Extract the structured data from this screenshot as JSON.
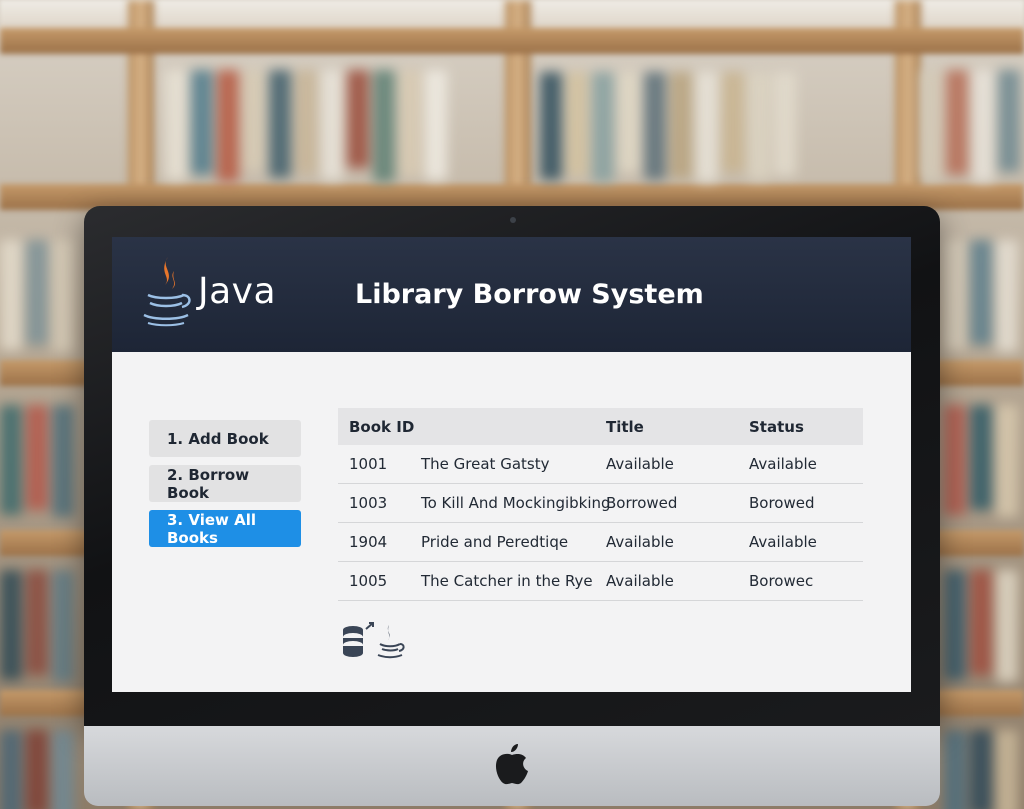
{
  "header": {
    "logo_text": "Java",
    "title": "Library Borrow System"
  },
  "menu": {
    "items": [
      {
        "label": "1. Add Book",
        "active": false
      },
      {
        "label": "2. Borrow Book",
        "active": false
      },
      {
        "label": "3. View All Books",
        "active": true
      }
    ]
  },
  "table": {
    "columns": [
      "Book ID",
      "",
      "Title",
      "Status"
    ],
    "rows": [
      [
        "1001",
        "The Great Gatsty",
        "Available",
        "Available"
      ],
      [
        "1003",
        "To Kill And Mockingibking",
        "Borrowed",
        "Borowed"
      ],
      [
        "1904",
        "Pride and Perеdtiqe",
        "Available",
        "Available"
      ],
      [
        "1005",
        "The Catcher in the Rye",
        "Available",
        "Borowec"
      ]
    ]
  },
  "footer_icons": [
    "database-icon",
    "java-cup-icon"
  ],
  "colors": {
    "header_bg": "#1d2536",
    "accent": "#1e8fe6",
    "java_orange": "#e8762b",
    "java_blue": "#5a8fc8"
  }
}
